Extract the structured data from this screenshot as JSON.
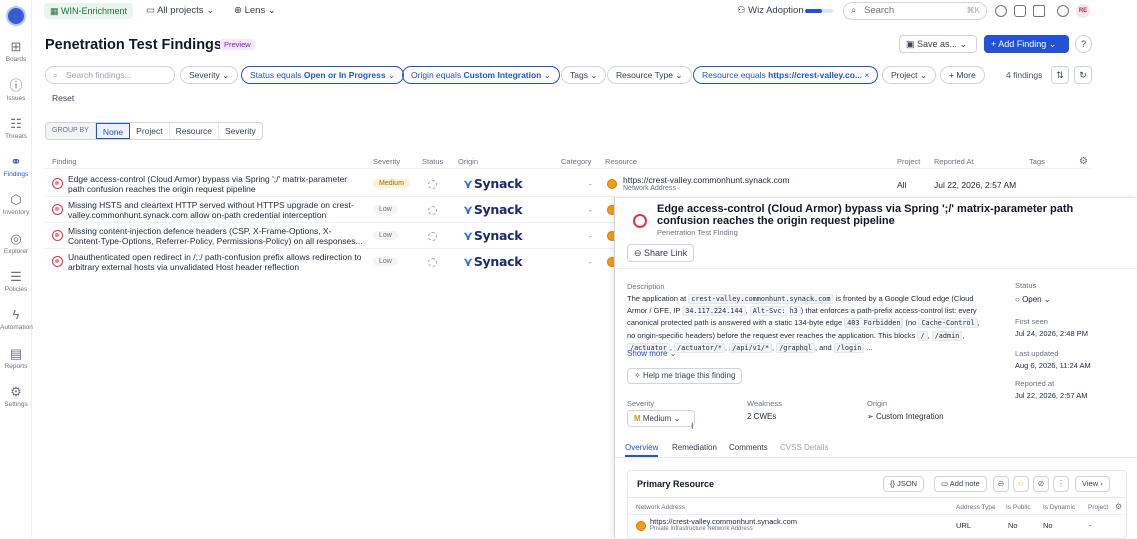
{
  "topbar": {
    "workspace": "WIN-Enrichment",
    "projects": "All projects",
    "lens": "Lens",
    "adoption": "Wiz Adoption",
    "adoption_progress": 0.6,
    "search_placeholder": "Search",
    "search_shortcut": "⌘K",
    "avatar_initials": "RE"
  },
  "rail": [
    {
      "label": "Boards",
      "icon": "grid-icon"
    },
    {
      "label": "Issues",
      "icon": "alert-icon"
    },
    {
      "label": "Threats",
      "icon": "threat-icon"
    },
    {
      "label": "Findings",
      "icon": "binoculars-icon"
    },
    {
      "label": "Inventory",
      "icon": "cube-icon"
    },
    {
      "label": "Explorer",
      "icon": "compass-icon"
    },
    {
      "label": "Policies",
      "icon": "policy-icon"
    },
    {
      "label": "Automation",
      "icon": "bolt-icon"
    },
    {
      "label": "Reports",
      "icon": "report-icon"
    },
    {
      "label": "Settings",
      "icon": "gear-icon"
    }
  ],
  "header": {
    "title": "Penetration Test Findings",
    "badge": "Preview",
    "save_as": "Save as...",
    "add_finding": "+ Add Finding"
  },
  "filters": {
    "search_placeholder": "Search findings...",
    "severity": "Severity",
    "status_prefix": "Status equals ",
    "status_value": "Open or In Progress",
    "origin_prefix": "Origin equals ",
    "origin_value": "Custom Integration",
    "tags": "Tags",
    "resource_type": "Resource Type",
    "resource_prefix": "Resource equals ",
    "resource_value": "https://crest-valley.co...",
    "project": "Project",
    "more": "+ More",
    "count": "4 findings",
    "reset": "Reset"
  },
  "group_by": {
    "label": "GROUP BY",
    "options": [
      "None",
      "Project",
      "Resource",
      "Severity"
    ],
    "selected": "None"
  },
  "table": {
    "headers": [
      "Finding",
      "Severity",
      "Status",
      "Origin",
      "Category",
      "Resource",
      "Project",
      "Reported At",
      "Tags"
    ],
    "rows": [
      {
        "finding": "Edge access-control (Cloud Armor) bypass via Spring ';/' matrix-parameter path confusion reaches the origin request pipeline",
        "severity": "Medium",
        "origin": "Synack",
        "category": "-",
        "resource": "https://crest-valley.commonhunt.synack.com",
        "resource_type": "Network Address",
        "project": "All",
        "reported_at": "Jul 22, 2026, 2:57 AM"
      },
      {
        "finding": "Missing HSTS and cleartext HTTP served without HTTPS upgrade on crest-valley.commonhunt.synack.com allow on-path credential interception",
        "severity": "Low",
        "origin": "Synack",
        "category": "-"
      },
      {
        "finding": "Missing content-injection defence headers (CSP, X-Frame-Options, X-Content-Type-Options, Referrer-Policy, Permissions-Policy) on all responses...",
        "severity": "Low",
        "origin": "Synack",
        "category": "-"
      },
      {
        "finding": "Unauthenticated open redirect in /;:/ path-confusion prefix allows redirection to arbitrary external hosts via unvalidated Host header reflection",
        "severity": "Low",
        "origin": "Synack",
        "category": "-"
      }
    ]
  },
  "drawer": {
    "title": "Edge access-control (Cloud Armor) bypass via Spring ';/' matrix-parameter path confusion reaches the origin request pipeline",
    "subtitle": "Penetration Test Finding",
    "share": "Share Link",
    "description_label": "Description",
    "desc": {
      "t1": "The application at ",
      "c1": "crest-valley.commonhunt.synack.com",
      "t2": " is fronted by a Google Cloud edge (Cloud Armor / GFE, IP ",
      "c2": "34.117.224.144",
      "t3": ", ",
      "c3": "Alt-Svc: h3",
      "t4": ") that enforces a path-prefix access-control list: every canonical protected path is answered with a static 134-byte edge ",
      "c4": "403 Forbidden",
      "t5": " (no ",
      "c5": "Cache-Control",
      "t6": ", no origin-specific headers) before the request ever reaches the application. This blocks ",
      "c6": "/",
      "t7": ", ",
      "c7": "/admin",
      "t8": ", ",
      "c8": "/actuator",
      "t9": ", ",
      "c9": "/actuator/*",
      "t10": ", ",
      "c10": "/api/v1/*",
      "t11": ", ",
      "c11": "/graphql",
      "t12": ", and ",
      "c12": "/login",
      "t13": " ..."
    },
    "show_more": "Show more",
    "triage": "Help me triage this finding",
    "severity_label": "Severity",
    "severity_value": "Medium",
    "weakness_label": "Weakness",
    "weakness_value": "2 CWEs",
    "origin_label": "Origin",
    "origin_value": "Custom Integration",
    "status_label": "Status",
    "status_value": "Open",
    "first_seen_label": "First seen",
    "first_seen": "Jul 24, 2026, 2:48 PM",
    "last_updated_label": "Last updated",
    "last_updated": "Aug 6, 2026, 11:24 AM",
    "reported_label": "Reported at",
    "reported": "Jul 22, 2026, 2:57 AM",
    "tabs": [
      "Overview",
      "Remediation",
      "Comments",
      "CVSS Details"
    ],
    "card": {
      "title": "Primary Resource",
      "json": "JSON",
      "add_note": "Add note",
      "view": "View",
      "headers": [
        "Network Address",
        "Address Type",
        "Is Public",
        "Is Dynamic",
        "Project"
      ],
      "address": "https://crest-valley.commonhunt.synack.com",
      "address_sub": "Private Infrastructure Network Address",
      "type": "URL",
      "public": "No",
      "dynamic": "No",
      "project": "-"
    }
  }
}
